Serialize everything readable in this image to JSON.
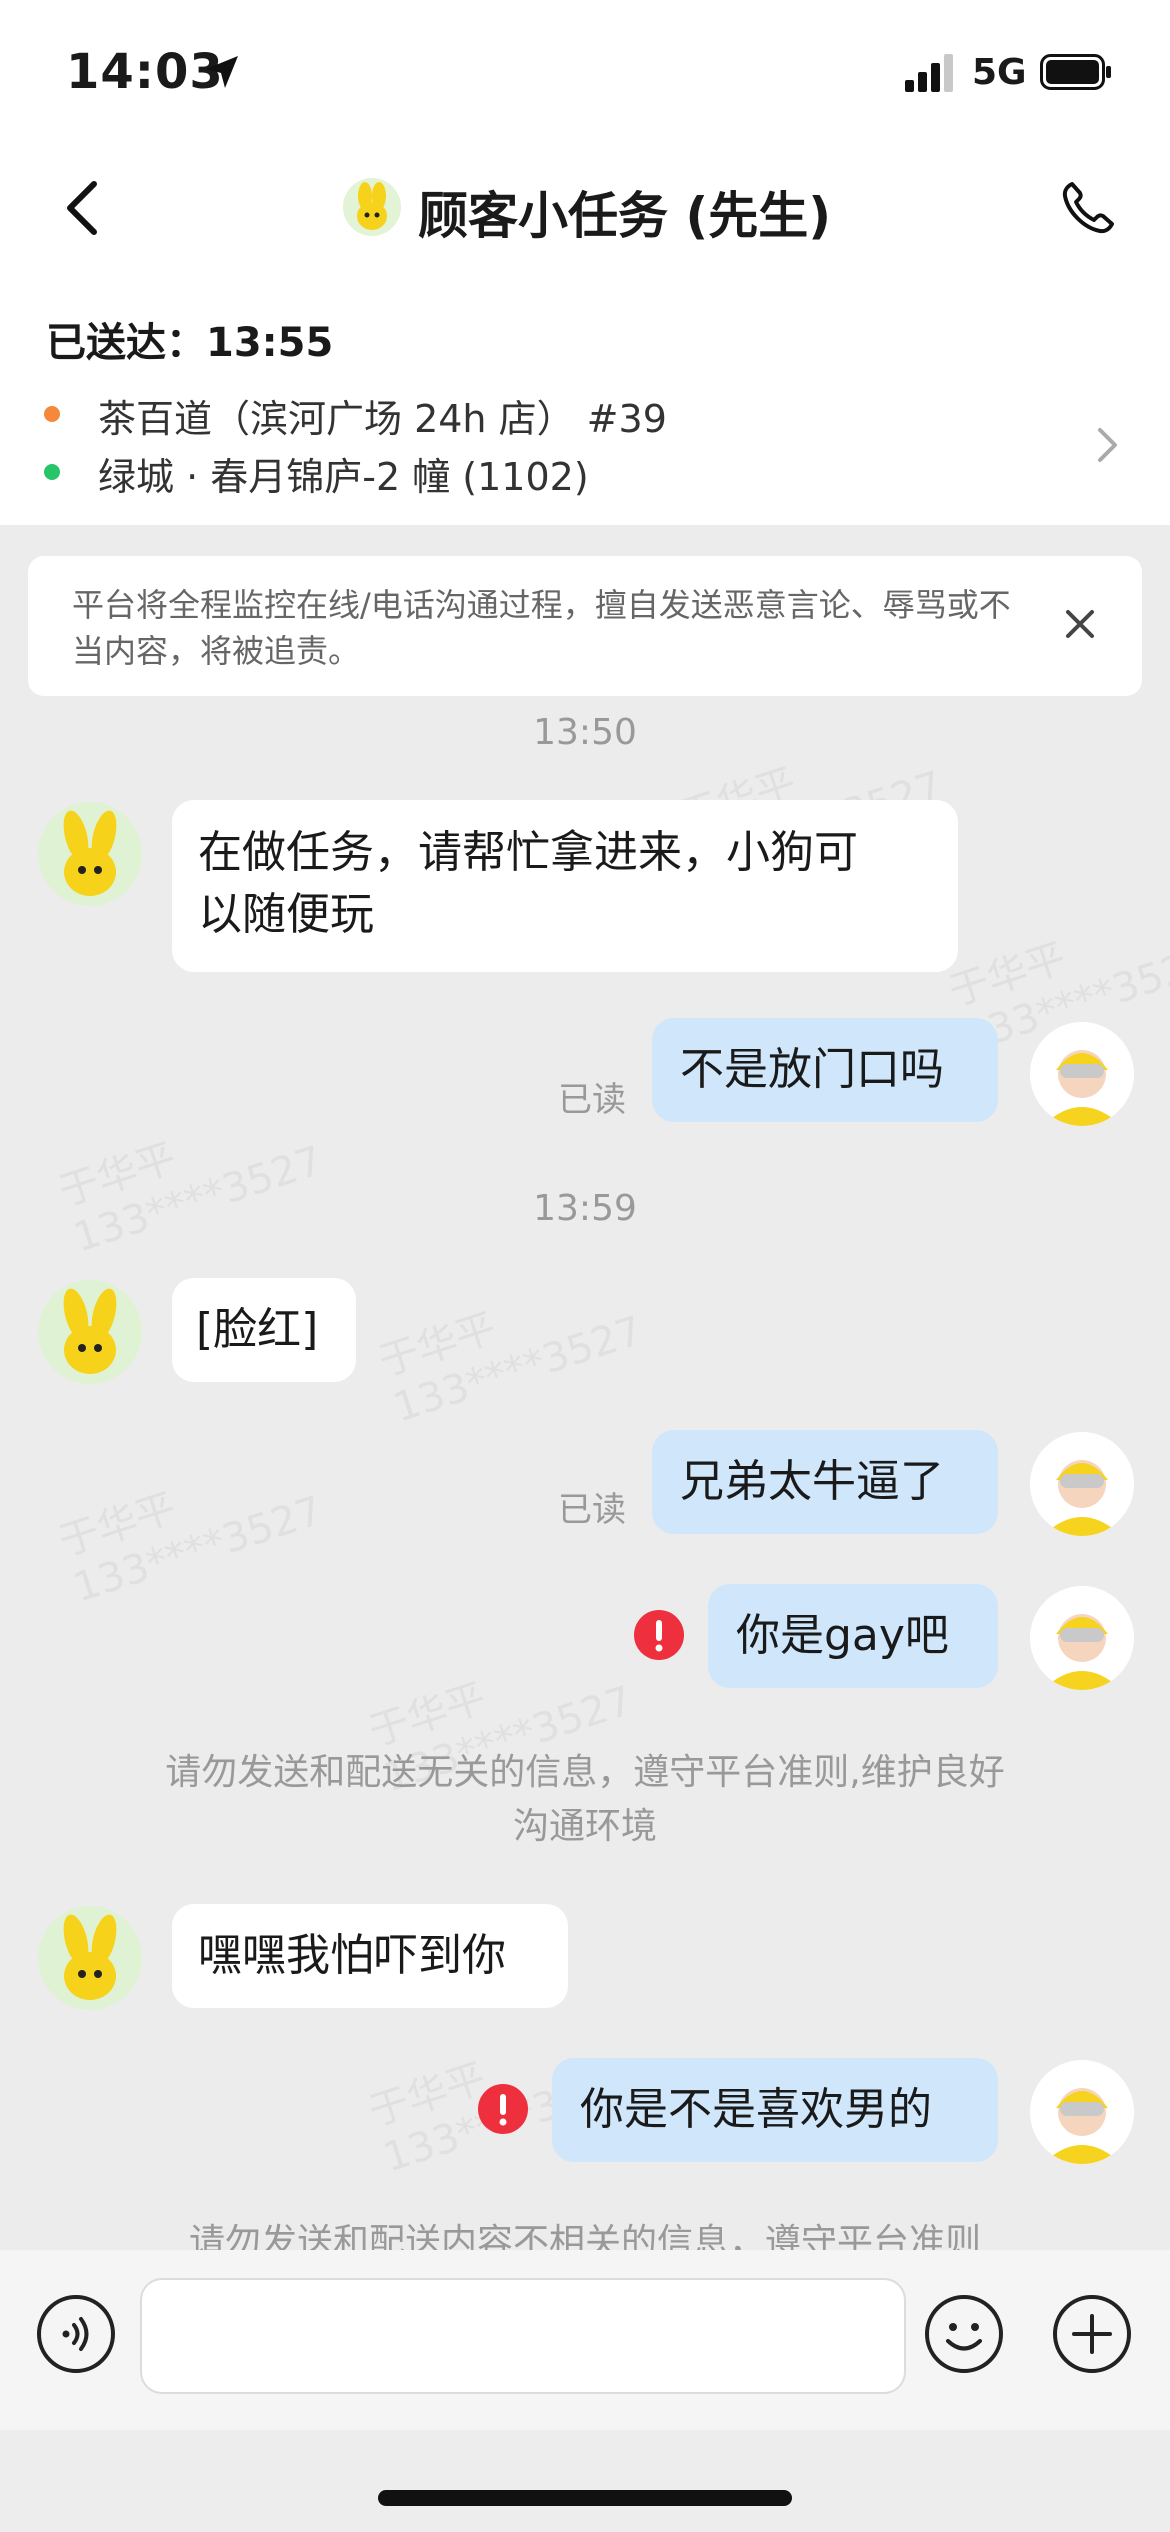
{
  "status_bar": {
    "time": "14:03",
    "network": "5G"
  },
  "header": {
    "title": "顾客小任务 (先生)"
  },
  "order": {
    "delivered_label": "已送达：13:55",
    "pickup": "茶百道（滨河广场 24h 店） #39",
    "dropoff": "绿城 · 春月锦庐-2 幢 (1102)",
    "pickup_dot_color": "#f5883a",
    "dropoff_dot_color": "#27c468"
  },
  "warning": {
    "text": "平台将全程监控在线/电话沟通过程，擅自发送恶意言论、辱骂或不当内容，将被追责。"
  },
  "chat": {
    "timestamps": [
      "13:50",
      "13:59"
    ],
    "read_label": "已读",
    "messages": [
      {
        "side": "left",
        "text_line1": "在做任务，请帮忙拿进来，小狗可",
        "text_line2": "以随便玩"
      },
      {
        "side": "right",
        "text": "不是放门口吗",
        "status": "已读"
      },
      {
        "side": "left",
        "text": "[脸红]"
      },
      {
        "side": "right",
        "text": "兄弟太牛逼了",
        "status": "已读"
      },
      {
        "side": "right",
        "text": "你是gay吧",
        "status": "failed"
      },
      {
        "side": "left",
        "text": "嘿嘿我怕吓到你"
      },
      {
        "side": "right",
        "text": "你是不是喜欢男的",
        "status": "failed"
      }
    ],
    "system_notice_1_line1": "请勿发送和配送无关的信息，遵守平台准则,维护良好",
    "system_notice_1_line2": "沟通环境",
    "system_notice_2": "请勿发送和配送内容不相关的信息，遵守平台准则"
  },
  "watermark": {
    "line1": "于华平",
    "line2": "133****3527"
  },
  "colors": {
    "bubble_right": "#cfe6fb",
    "error_red": "#ee2f3d",
    "background": "#ececec"
  }
}
